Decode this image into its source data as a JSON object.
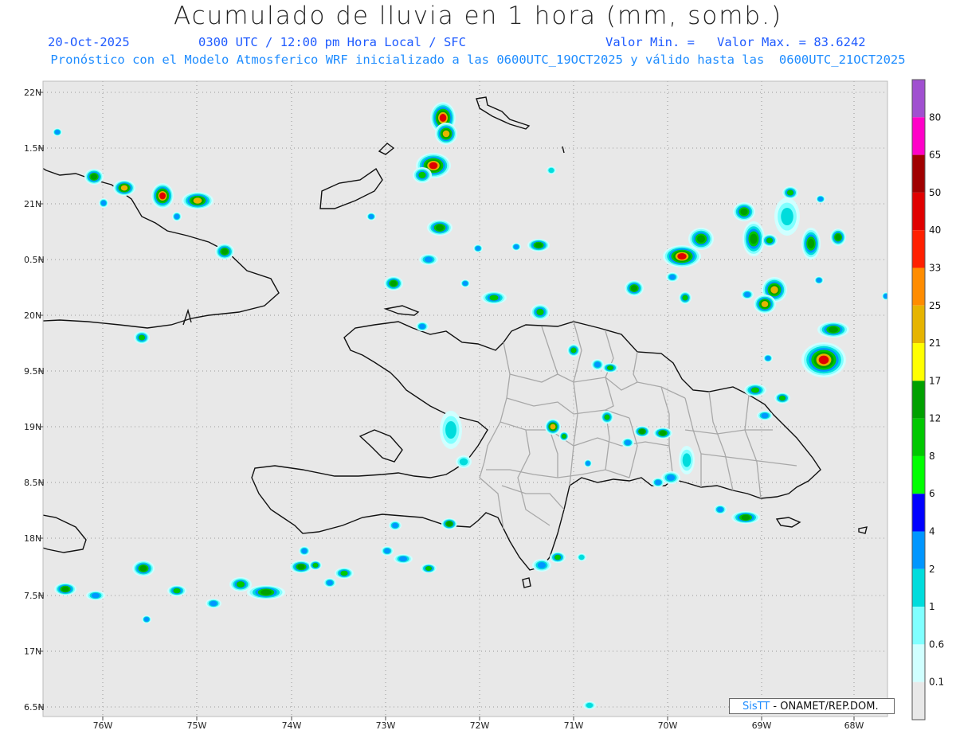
{
  "header": {
    "title": "Acumulado de lluvia en 1 hora (mm, somb.)",
    "date": "20-Oct-2025",
    "time": "0300 UTC / 12:00 pm Hora Local / SFC",
    "valor_min": "Valor Min. =",
    "valor_max": "Valor Max. = 83.6242",
    "forecast_line": "Pronóstico con el Modelo Atmosferico WRF inicializado a las 0600UTC_19OCT2025 y válido hasta las  0600UTC_21OCT2025"
  },
  "axes": {
    "lat_labels": [
      "22N",
      "1.5N",
      "21N",
      "0.5N",
      "20N",
      "9.5N",
      "19N",
      "8.5N",
      "18N",
      "7.5N",
      "17N",
      "6.5N"
    ],
    "lon_labels": [
      "76W",
      "75W",
      "74W",
      "73W",
      "72W",
      "71W",
      "70W",
      "69W",
      "68W"
    ]
  },
  "colorbar": {
    "labels": [
      "80",
      "65",
      "50",
      "40",
      "33",
      "25",
      "21",
      "17",
      "12",
      "8",
      "6",
      "4",
      "2",
      "1",
      "0.6",
      "0.1"
    ],
    "colors": [
      "#a050d0",
      "#ff00c8",
      "#a00000",
      "#e00000",
      "#ff2000",
      "#ff8c00",
      "#e6b400",
      "#ffff00",
      "#00a000",
      "#00c800",
      "#00ff00",
      "#0000ff",
      "#0096ff",
      "#00dcdc",
      "#80ffff",
      "#d0ffff",
      "#e8e8e8"
    ]
  },
  "credit": {
    "brand": "SisTT",
    "text": " - ONAMET/REP.DOM."
  }
}
